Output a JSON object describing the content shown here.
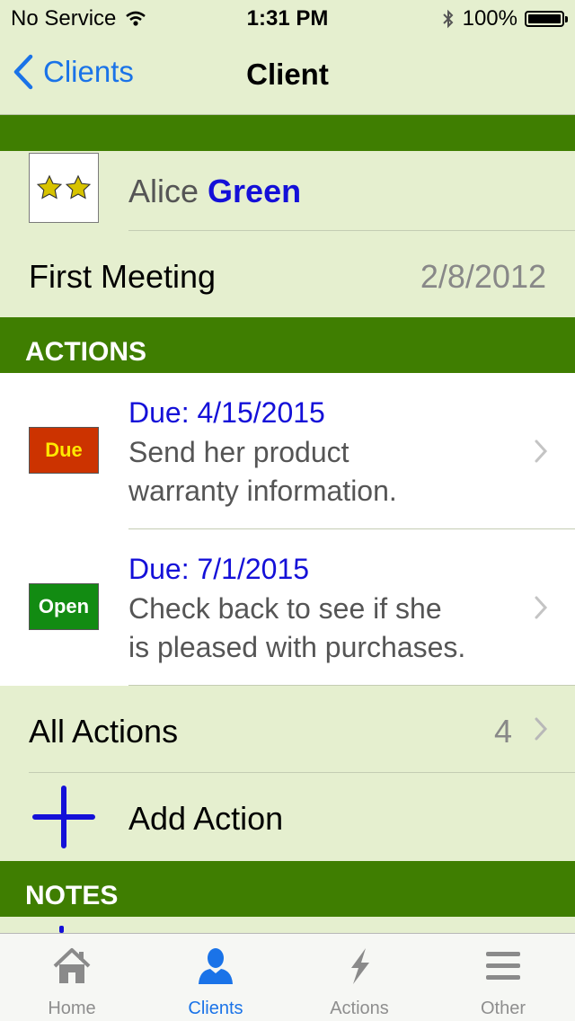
{
  "status_bar": {
    "carrier": "No Service",
    "time": "1:31 PM",
    "battery": "100%"
  },
  "nav": {
    "back_label": "Clients",
    "title": "Client"
  },
  "client": {
    "first_name": "Alice",
    "last_name": "Green",
    "rating_stars": 2,
    "meeting_label": "First Meeting",
    "meeting_date": "2/8/2012"
  },
  "actions_section": {
    "header": "ACTIONS",
    "items": [
      {
        "status": "Due",
        "status_color": "#cc3300",
        "status_text_color": "#ffe800",
        "due": "Due: 4/15/2015",
        "line1": "Send her product",
        "line2": "warranty information."
      },
      {
        "status": "Open",
        "status_color": "#128b12",
        "status_text_color": "#ffffff",
        "due": "Due: 7/1/2015",
        "line1": "Check back to see if she",
        "line2": "is pleased with purchases."
      }
    ],
    "all_label": "All Actions",
    "all_count": "4",
    "add_label": "Add Action"
  },
  "notes_section": {
    "header": "NOTES"
  },
  "tabs": [
    {
      "label": "Home",
      "icon": "home-icon",
      "active": false
    },
    {
      "label": "Clients",
      "icon": "person-icon",
      "active": true
    },
    {
      "label": "Actions",
      "icon": "lightning-icon",
      "active": false
    },
    {
      "label": "Other",
      "icon": "menu-icon",
      "active": false
    }
  ],
  "colors": {
    "background": "#e5efcf",
    "section_green": "#3f7e01",
    "accent_blue": "#1a73e8",
    "name_blue": "#1410d8"
  }
}
